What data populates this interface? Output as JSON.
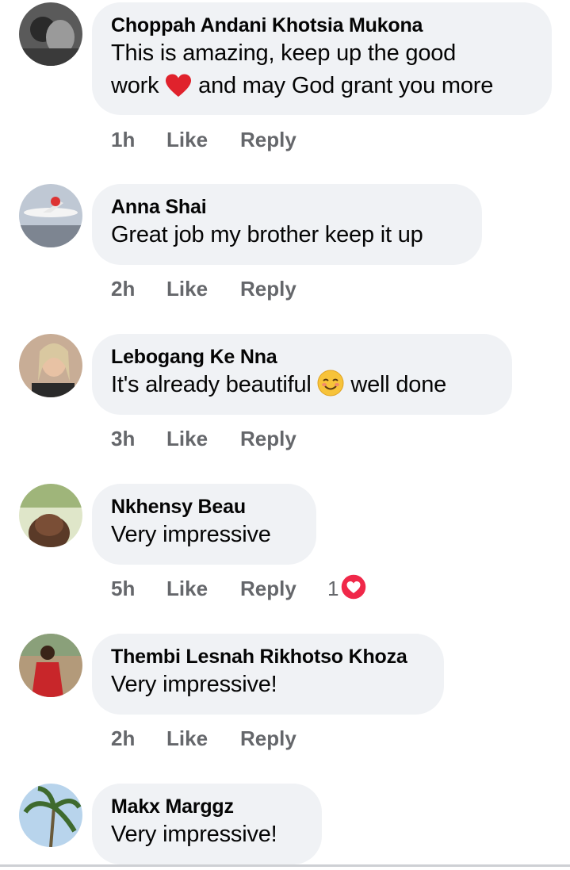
{
  "comments": [
    {
      "author": "Choppah Andani Khotsia Mukona",
      "text_line1": "This is amazing, keep up the good",
      "text_line2_a": "work",
      "text_line2_b": "and may God grant you more",
      "time": "1h",
      "like": "Like",
      "reply": "Reply"
    },
    {
      "author": "Anna Shai",
      "text": "Great job my brother keep it up",
      "time": "2h",
      "like": "Like",
      "reply": "Reply"
    },
    {
      "author": "Lebogang Ke Nna",
      "text_a": "It's already beautiful",
      "text_b": "well done",
      "time": "3h",
      "like": "Like",
      "reply": "Reply"
    },
    {
      "author": "Nkhensy Beau",
      "text": "Very impressive",
      "time": "5h",
      "like": "Like",
      "reply": "Reply",
      "reaction_count": "1"
    },
    {
      "author": "Thembi Lesnah Rikhotso Khoza",
      "text": "Very impressive!",
      "time": "2h",
      "like": "Like",
      "reply": "Reply"
    },
    {
      "author": "Makx Marggz",
      "text": "Very impressive!"
    }
  ],
  "icons": [
    "heart-emoji-icon",
    "smiling-face-emoji-icon",
    "love-reaction-icon"
  ],
  "colors": {
    "bubble": "#f0f2f5",
    "meta_text": "#65676b",
    "heart": "#f02849"
  }
}
